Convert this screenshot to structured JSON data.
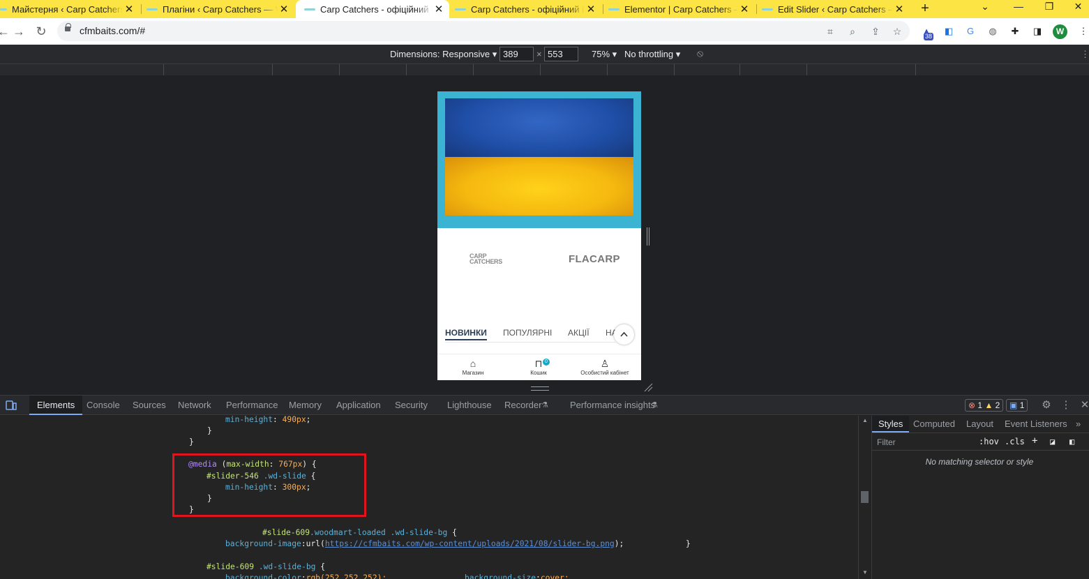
{
  "browser": {
    "tabs": [
      {
        "title": "Майстерня ‹ Carp Catchers — WordPress"
      },
      {
        "title": "Плагіни ‹ Carp Catchers — WordPress"
      },
      {
        "title": "Carp Catchers - офіційний інтернет-магазин"
      },
      {
        "title": "Carp Catchers - офіційний інтернет-магазин"
      },
      {
        "title": "Elementor | Carp Catchers – офіційний"
      },
      {
        "title": "Edit Slider ‹ Carp Catchers — WordPress"
      }
    ],
    "active_tab_index": 2,
    "new_tab_label": "+",
    "url": "cfmbaits.com/#",
    "extension_badge": "38",
    "profile_initial": "W"
  },
  "device_toolbar": {
    "dimensions_label": "Dimensions: Responsive",
    "width": "389",
    "height": "553",
    "times": "×",
    "zoom": "75%",
    "throttling": "No throttling"
  },
  "page": {
    "brand_left_line1": "CARP",
    "brand_left_line2": "CATCHERS",
    "brand_right": "FLACARP",
    "product_tabs": [
      "НОВИНКИ",
      "ПОПУЛЯРНІ",
      "АКЦІЇ",
      "НА"
    ],
    "bottom_nav": [
      {
        "label": "Магазин",
        "icon": "store-icon"
      },
      {
        "label": "Кошик",
        "icon": "cart-icon",
        "badge": "0"
      },
      {
        "label": "Особистий кабінет",
        "icon": "user-icon"
      }
    ]
  },
  "devtools": {
    "tabs": [
      "Elements",
      "Console",
      "Sources",
      "Network",
      "Performance",
      "Memory",
      "Application",
      "Security",
      "Lighthouse",
      "Recorder",
      "Performance insights"
    ],
    "active_tab": "Elements",
    "errors": "1",
    "warnings": "2",
    "messages": "1",
    "code": {
      "l1_prop": "min-height",
      "l1_val": "490px",
      "l2": "}",
      "l3": "}",
      "media_kw": "@media",
      "media_cond_open": "(",
      "media_feature": "max-width",
      "media_value": "767px",
      "media_cond_close": ") {",
      "sel_id": "#slider-546",
      "sel_cls": ".wd-slide",
      "brace_open": "{",
      "prop_min_height": "min-height",
      "val_300": "300px",
      "close_inner": "}",
      "close_outer": "}",
      "slide_bg_sel_id": "#slide-609",
      "slide_bg_sel_cls": ".woodmart-loaded",
      "slide_bg_sel_cls2": ".wd-slide-bg",
      "slide_bg_brace": "{",
      "bg_image_prop": "background-image",
      "bg_image_fn": "url(",
      "bg_image_url": "https://cfmbaits.com/wp-content/uploads/2021/08/slider-bg.png",
      "bg_image_close": ");",
      "bg_image_end": "}",
      "slide_sel_id": "#slide-609",
      "slide_sel_cls": ".wd-slide-bg",
      "slide_brace": "{",
      "bg_color_prop": "background-color",
      "bg_color_val": "rgb(252,252,252);",
      "bg_size_prop": "background-size",
      "bg_size_val": "cover;"
    },
    "styles": {
      "tabs": [
        "Styles",
        "Computed",
        "Layout",
        "Event Listeners"
      ],
      "filter_placeholder": "Filter",
      "hov": ":hov",
      "cls": ".cls",
      "empty_message": "No matching selector or style"
    }
  }
}
